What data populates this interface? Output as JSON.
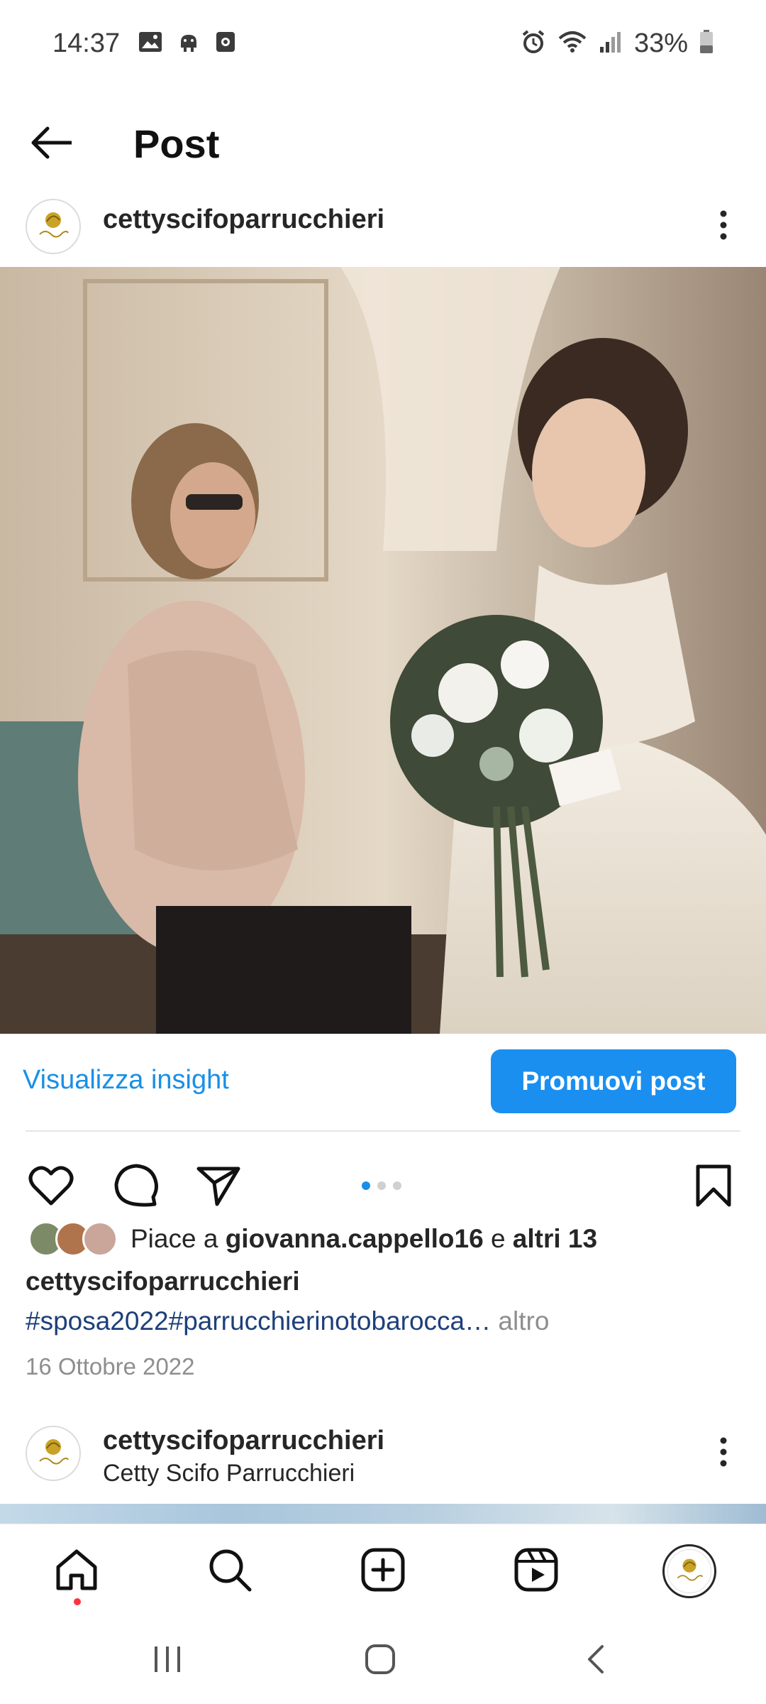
{
  "status_bar": {
    "time": "14:37",
    "battery": "33%",
    "icons_left": [
      "gallery-icon",
      "android-icon",
      "screen-record-icon"
    ],
    "icons_right": [
      "alarm-icon",
      "wifi-icon",
      "signal-icon",
      "battery-icon"
    ]
  },
  "header": {
    "title": "Post",
    "back_icon": "arrow-left-icon"
  },
  "post": {
    "author": "cettyscifoparrucchieri",
    "insight_label": "Visualizza insight",
    "promote_label": "Promuovi post",
    "carousel": {
      "count": 3,
      "active": 1
    },
    "likes": {
      "prefix": "Piace a",
      "user": "giovanna.cappello16",
      "middle": "e",
      "others": "altri 13"
    },
    "caption_user": "cettyscifoparrucchieri",
    "hashtags": "#sposa2022#parrucchierinotobarocca…",
    "more_label": "altro",
    "date": "16 Ottobre 2022"
  },
  "next_post": {
    "author": "cettyscifoparrucchieri",
    "subtitle": "Cetty Scifo Parrucchieri"
  },
  "colors": {
    "accent": "#1a8ff0",
    "link": "#1a8fe6",
    "hashtag": "#1e3f7a",
    "muted": "#8e8e8e",
    "notification": "#ff3040"
  },
  "bottom_nav": [
    "home-icon",
    "search-icon",
    "create-icon",
    "reels-icon",
    "profile-avatar"
  ],
  "system_nav": [
    "recents-icon",
    "home-button-icon",
    "back-icon"
  ]
}
